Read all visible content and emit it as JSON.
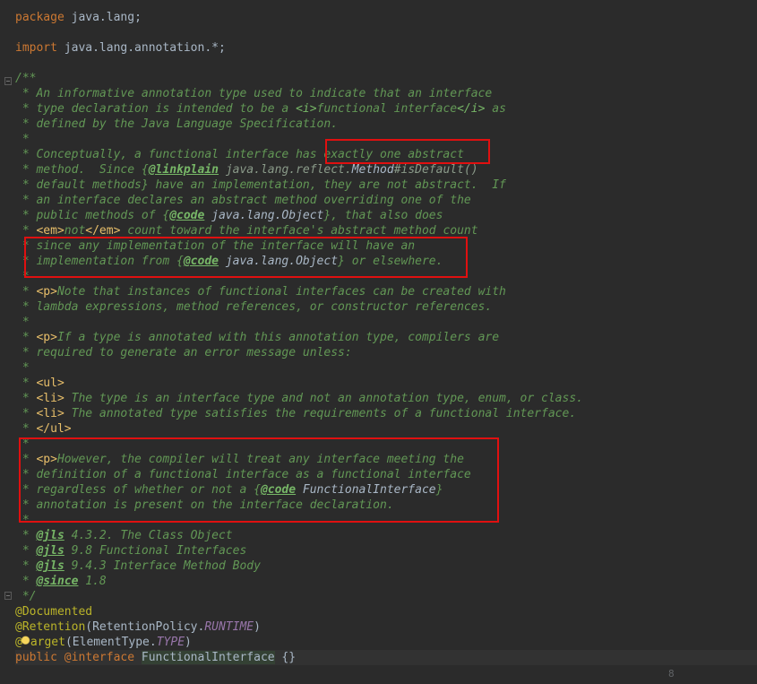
{
  "editor": {
    "lines": {
      "l1": {
        "kw": "package",
        "rest": " java.lang;"
      },
      "l3": {
        "kw": "import",
        "rest": " java.lang.annotation.*;"
      },
      "l5": {
        "text": "/**"
      },
      "l6": {
        "text": " * An informative annotation type used to indicate that an interface"
      },
      "l7": {
        "a": " * type declaration is intended to be a ",
        "t1": "<i>",
        "b": "functional interface",
        "t2": "</i>",
        "c": " as"
      },
      "l8": {
        "text": " * defined by the Java Language Specification."
      },
      "l9": {
        "text": " *"
      },
      "l10": {
        "text": " * Conceptually, a functional interface has exactly one abstract"
      },
      "l11": {
        "a": " * method.  Since {",
        "tag": "@linkplain",
        "ref": " java.lang.reflect.",
        "cls": "Method",
        "ref2": "#isDefault()"
      },
      "l12": {
        "text": " * default methods} have an implementation, they are not abstract.  If"
      },
      "l13": {
        "text": " * an interface declares an abstract method overriding one of the"
      },
      "l14": {
        "a": " * public methods of {",
        "tag": "@code",
        "ref": " java.lang.Object",
        "b": "}, that also does"
      },
      "l15": {
        "a": " * ",
        "t1": "<em>",
        "b": "not",
        "t2": "</em>",
        "c": " count toward the interface's abstract method count"
      },
      "l16": {
        "text": " * since any implementation of the interface will have an"
      },
      "l17": {
        "a": " * implementation from {",
        "tag": "@code",
        "ref": " java.lang.Object",
        "b": "} or elsewhere."
      },
      "l18": {
        "text": " *"
      },
      "l19": {
        "a": " * ",
        "t1": "<p>",
        "b": "Note that instances of functional interfaces can be created with"
      },
      "l20": {
        "text": " * lambda expressions, method references, or constructor references."
      },
      "l21": {
        "text": " *"
      },
      "l22": {
        "a": " * ",
        "t1": "<p>",
        "b": "If a type is annotated with this annotation type, compilers are"
      },
      "l23": {
        "text": " * required to generate an error message unless:"
      },
      "l24": {
        "text": " *"
      },
      "l25": {
        "a": " * ",
        "t1": "<ul>"
      },
      "l26": {
        "a": " * ",
        "t1": "<li>",
        "b": " The type is an interface type and not an annotation type, enum, or class."
      },
      "l27": {
        "a": " * ",
        "t1": "<li>",
        "b": " The annotated type satisfies the requirements of a functional interface."
      },
      "l28": {
        "a": " * ",
        "t1": "</ul>"
      },
      "l29": {
        "text": " *"
      },
      "l30": {
        "a": " * ",
        "t1": "<p>",
        "b": "However, the compiler will treat any interface meeting the"
      },
      "l31": {
        "text": " * definition of a functional interface as a functional interface"
      },
      "l32": {
        "a": " * regardless of whether or not a {",
        "tag": "@code",
        "ref": " FunctionalInterface",
        "b": "}"
      },
      "l33": {
        "text": " * annotation is present on the interface declaration."
      },
      "l34": {
        "text": " *"
      },
      "l35": {
        "a": " * ",
        "tag": "@jls",
        "b": " 4.3.2. The Class Object"
      },
      "l36": {
        "a": " * ",
        "tag": "@jls",
        "b": " 9.8 Functional Interfaces"
      },
      "l37": {
        "a": " * ",
        "tag": "@jls",
        "b": " 9.4.3 Interface Method Body"
      },
      "l38": {
        "a": " * ",
        "tag": "@since",
        "b": " 1.8"
      },
      "l39": {
        "text": " */"
      },
      "l40": {
        "ann": "@Documented"
      },
      "l41": {
        "ann": "@Retention",
        "a": "(RetentionPolicy.",
        "const": "RUNTIME",
        "b": ")"
      },
      "l42": {
        "ann1": "@",
        "ann2": "arget",
        "a": "(ElementType.",
        "const": "TYPE",
        "b": ")"
      },
      "l43": {
        "kw": "public",
        "kw2": " @interface",
        "sp": " ",
        "name": "FunctionalInterface",
        "b": " {}"
      }
    },
    "page_number": "8"
  }
}
